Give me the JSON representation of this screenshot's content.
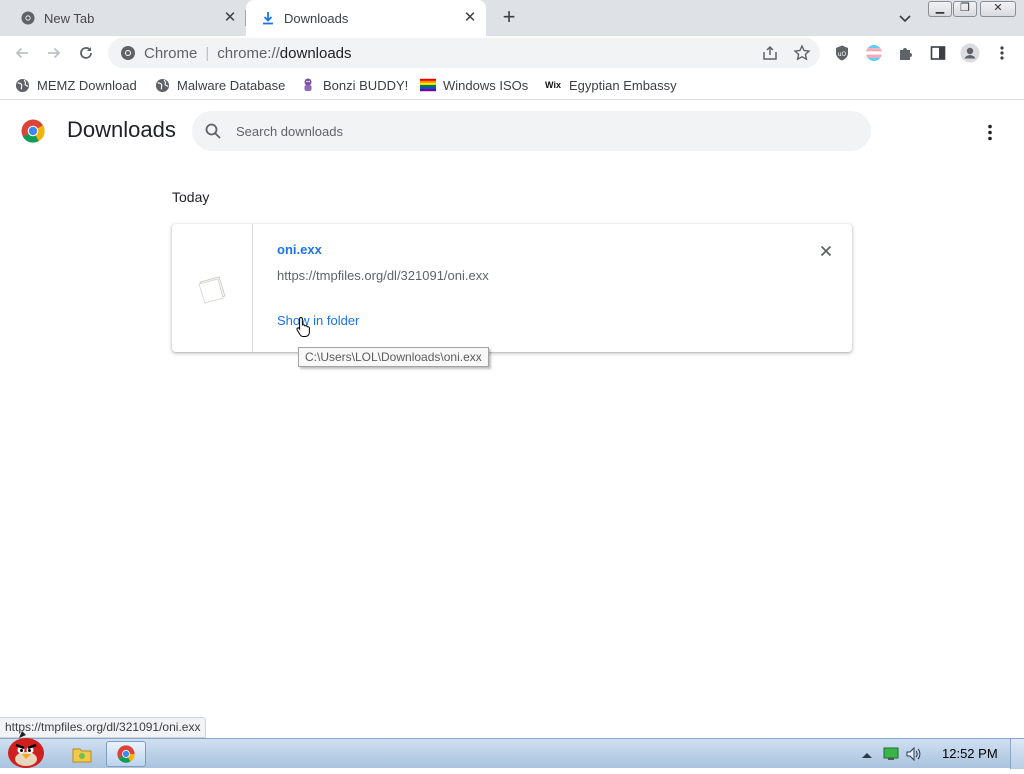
{
  "tabs": [
    {
      "title": "New Tab",
      "active": false
    },
    {
      "title": "Downloads",
      "active": true
    }
  ],
  "omnibox": {
    "scheme_label": "Chrome",
    "url_prefix": "chrome://",
    "url_host": "downloads"
  },
  "bookmarks": [
    {
      "label": "MEMZ Download",
      "icon": "globe-icon"
    },
    {
      "label": "Malware Database",
      "icon": "globe-icon"
    },
    {
      "label": "Bonzi BUDDY!",
      "icon": "bonzi-icon"
    },
    {
      "label": "Windows ISOs",
      "icon": "rainbow-flag-icon"
    },
    {
      "label": "Egyptian Embassy",
      "icon": "wix-icon"
    }
  ],
  "page": {
    "title": "Downloads",
    "search_placeholder": "Search downloads",
    "section_label": "Today"
  },
  "download": {
    "file_name": "oni.exx",
    "url": "https://tmpfiles.org/dl/321091/oni.exx",
    "action_label": "Show in folder",
    "tooltip": "C:\\Users\\LOL\\Downloads\\oni.exx"
  },
  "status_bubble": "https://tmpfiles.org/dl/321091/oni.exx",
  "taskbar": {
    "clock": "12:52 PM"
  },
  "colors": {
    "accent": "#1a73e8",
    "tabstrip": "#dee1e6",
    "taskbar": "#b9d1ea"
  }
}
